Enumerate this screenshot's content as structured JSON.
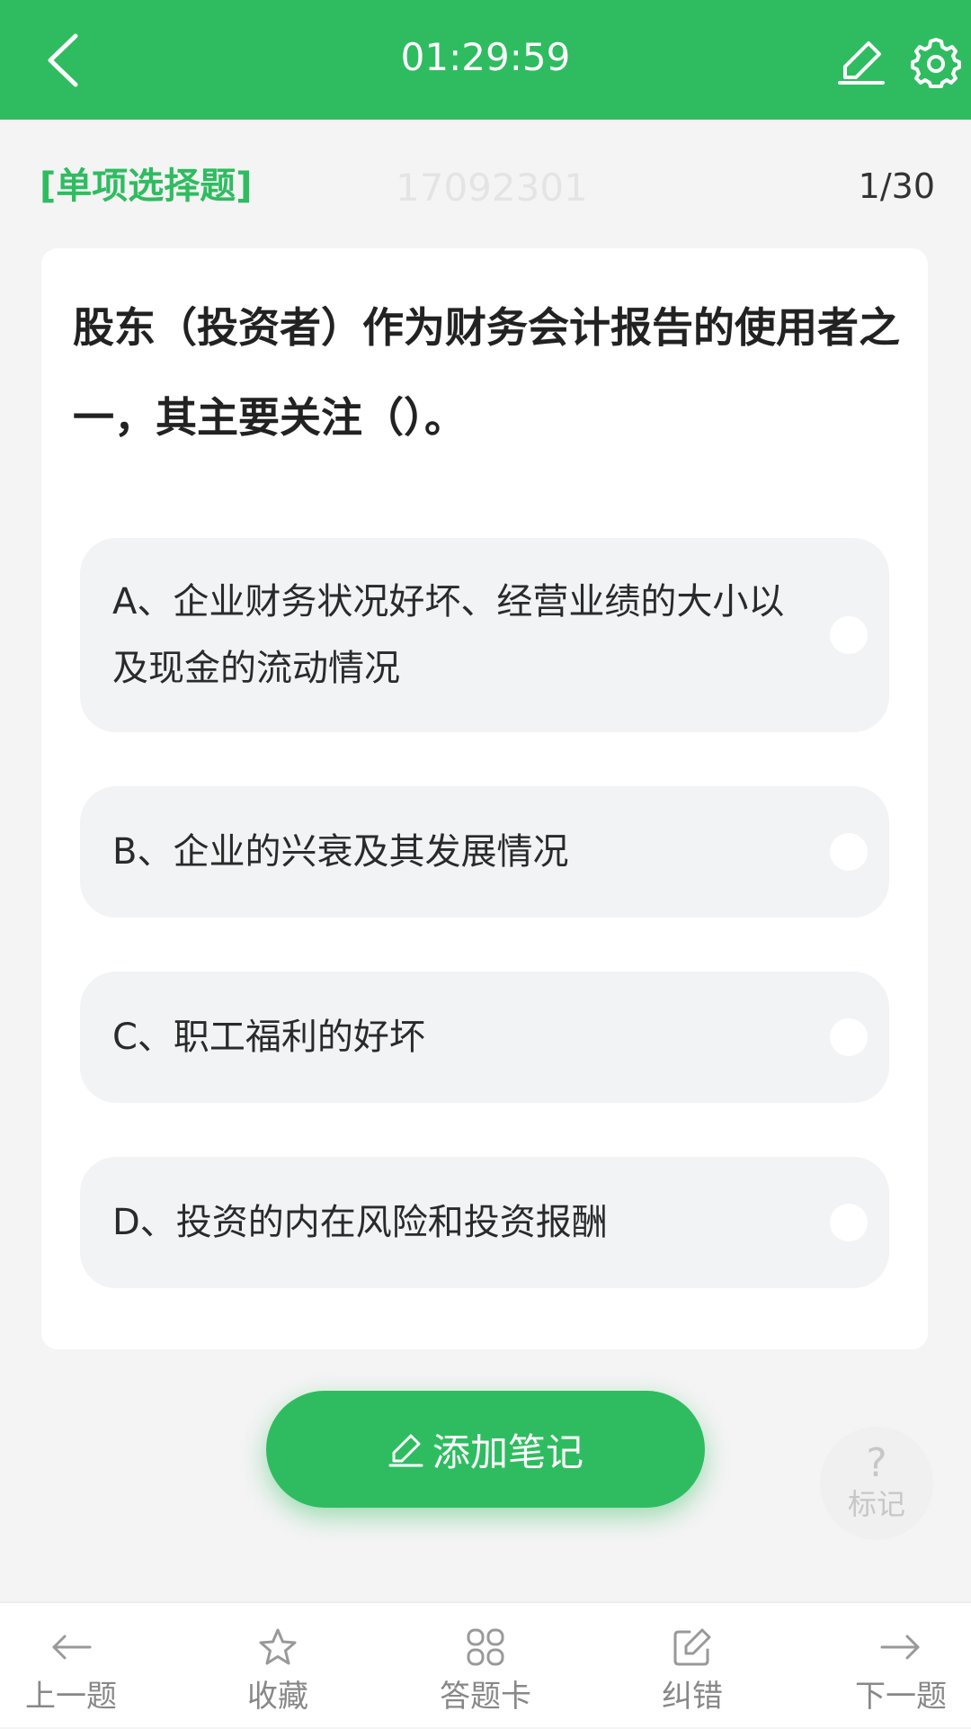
{
  "header": {
    "timer": "01:29:59",
    "background_color": "#2fbc60",
    "icons": [
      "chevron-left-icon",
      "pencil-icon",
      "gear-icon"
    ]
  },
  "question_meta": {
    "type_label": "[单项选择题]",
    "question_id": "17092301",
    "progress": "1/30"
  },
  "question": {
    "text": "股东（投资者）作为财务会计报告的使用者之一，其主要关注（）。",
    "options": [
      {
        "label": "A、企业财务状况好坏、经营业绩的大小以及现金的流动情况",
        "selected": false
      },
      {
        "label": "B、企业的兴衰及其发展情况",
        "selected": false
      },
      {
        "label": "C、职工福利的好坏",
        "selected": false
      },
      {
        "label": "D、投资的内在风险和投资报酬",
        "selected": false
      }
    ]
  },
  "actions": {
    "add_note_label": "添加笔记",
    "mark_icon_text": "?",
    "mark_label": "标记"
  },
  "bottom_nav": {
    "items": [
      {
        "label": "上一题",
        "icon": "arrow-left-icon"
      },
      {
        "label": "收藏",
        "icon": "star-icon"
      },
      {
        "label": "答题卡",
        "icon": "grid-icon"
      },
      {
        "label": "纠错",
        "icon": "edit-square-icon"
      },
      {
        "label": "下一题",
        "icon": "arrow-right-icon"
      }
    ]
  }
}
